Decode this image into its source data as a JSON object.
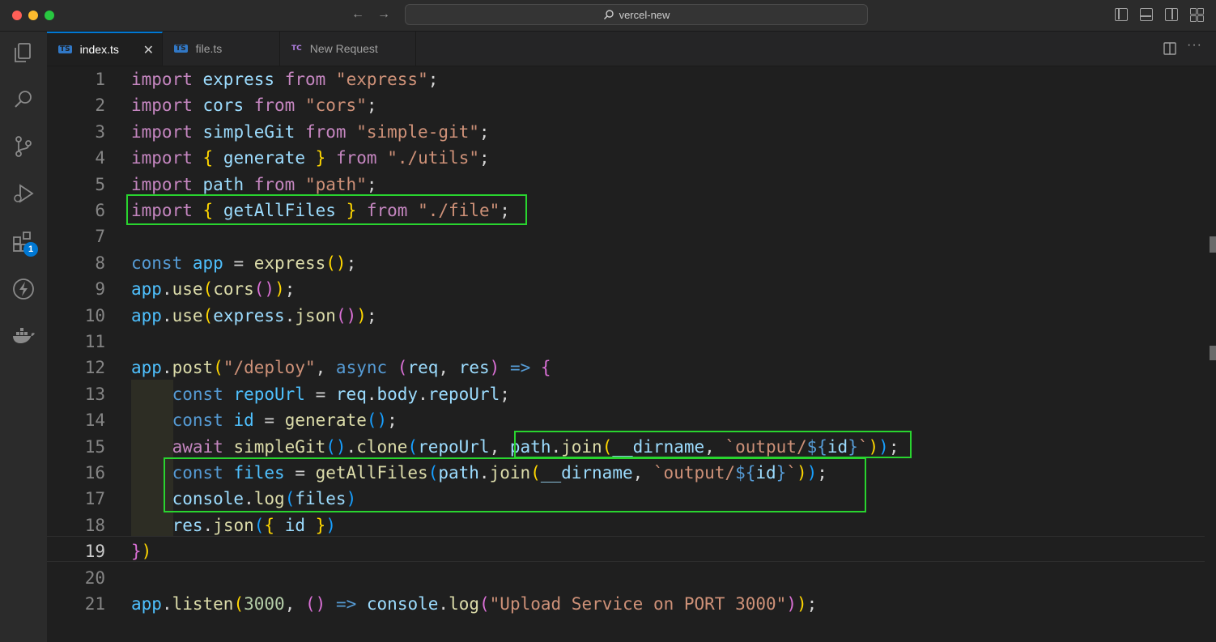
{
  "window": {
    "search_text": "vercel-new",
    "colors": {
      "close": "#ff5f57",
      "minimize": "#febc2e",
      "zoom": "#28c840",
      "accent": "#0078d4",
      "highlight": "#29d42f"
    }
  },
  "activity": {
    "extensions_badge": "1"
  },
  "tabs": [
    {
      "label": "index.ts",
      "icon": "TS",
      "active": true
    },
    {
      "label": "file.ts",
      "icon": "TS",
      "active": false
    },
    {
      "label": "New Request",
      "icon": "TC",
      "active": false
    }
  ],
  "editor": {
    "current_line": 19,
    "lines": [
      {
        "n": "1",
        "tokens": [
          [
            "kw",
            "import"
          ],
          [
            "pn",
            " "
          ],
          [
            "vr",
            "express"
          ],
          [
            "pn",
            " "
          ],
          [
            "kw",
            "from"
          ],
          [
            "pn",
            " "
          ],
          [
            "st",
            "\"express\""
          ],
          [
            "pn",
            ";"
          ]
        ]
      },
      {
        "n": "2",
        "tokens": [
          [
            "kw",
            "import"
          ],
          [
            "pn",
            " "
          ],
          [
            "vr",
            "cors"
          ],
          [
            "pn",
            " "
          ],
          [
            "kw",
            "from"
          ],
          [
            "pn",
            " "
          ],
          [
            "st",
            "\"cors\""
          ],
          [
            "pn",
            ";"
          ]
        ]
      },
      {
        "n": "3",
        "tokens": [
          [
            "kw",
            "import"
          ],
          [
            "pn",
            " "
          ],
          [
            "vr",
            "simpleGit"
          ],
          [
            "pn",
            " "
          ],
          [
            "kw",
            "from"
          ],
          [
            "pn",
            " "
          ],
          [
            "st",
            "\"simple-git\""
          ],
          [
            "pn",
            ";"
          ]
        ]
      },
      {
        "n": "4",
        "tokens": [
          [
            "kw",
            "import"
          ],
          [
            "pn",
            " "
          ],
          [
            "b1",
            "{"
          ],
          [
            "pn",
            " "
          ],
          [
            "vr",
            "generate"
          ],
          [
            "pn",
            " "
          ],
          [
            "b1",
            "}"
          ],
          [
            "pn",
            " "
          ],
          [
            "kw",
            "from"
          ],
          [
            "pn",
            " "
          ],
          [
            "st",
            "\"./utils\""
          ],
          [
            "pn",
            ";"
          ]
        ]
      },
      {
        "n": "5",
        "tokens": [
          [
            "kw",
            "import"
          ],
          [
            "pn",
            " "
          ],
          [
            "vr",
            "path"
          ],
          [
            "pn",
            " "
          ],
          [
            "kw",
            "from"
          ],
          [
            "pn",
            " "
          ],
          [
            "st",
            "\"path\""
          ],
          [
            "pn",
            ";"
          ]
        ]
      },
      {
        "n": "6",
        "tokens": [
          [
            "kw",
            "import"
          ],
          [
            "pn",
            " "
          ],
          [
            "b1",
            "{"
          ],
          [
            "pn",
            " "
          ],
          [
            "vr",
            "getAllFiles"
          ],
          [
            "pn",
            " "
          ],
          [
            "b1",
            "}"
          ],
          [
            "pn",
            " "
          ],
          [
            "kw",
            "from"
          ],
          [
            "pn",
            " "
          ],
          [
            "st",
            "\"./file\""
          ],
          [
            "pn",
            ";"
          ]
        ]
      },
      {
        "n": "7",
        "tokens": []
      },
      {
        "n": "8",
        "tokens": [
          [
            "dc",
            "const"
          ],
          [
            "pn",
            " "
          ],
          [
            "cn",
            "app"
          ],
          [
            "pn",
            " = "
          ],
          [
            "fn",
            "express"
          ],
          [
            "b1",
            "()"
          ],
          [
            "pn",
            ";"
          ]
        ]
      },
      {
        "n": "9",
        "tokens": [
          [
            "cn",
            "app"
          ],
          [
            "pn",
            "."
          ],
          [
            "fn",
            "use"
          ],
          [
            "b1",
            "("
          ],
          [
            "fn",
            "cors"
          ],
          [
            "b2",
            "()"
          ],
          [
            "b1",
            ")"
          ],
          [
            "pn",
            ";"
          ]
        ]
      },
      {
        "n": "10",
        "tokens": [
          [
            "cn",
            "app"
          ],
          [
            "pn",
            "."
          ],
          [
            "fn",
            "use"
          ],
          [
            "b1",
            "("
          ],
          [
            "vr",
            "express"
          ],
          [
            "pn",
            "."
          ],
          [
            "fn",
            "json"
          ],
          [
            "b2",
            "()"
          ],
          [
            "b1",
            ")"
          ],
          [
            "pn",
            ";"
          ]
        ]
      },
      {
        "n": "11",
        "tokens": []
      },
      {
        "n": "12",
        "tokens": [
          [
            "cn",
            "app"
          ],
          [
            "pn",
            "."
          ],
          [
            "fn",
            "post"
          ],
          [
            "b1",
            "("
          ],
          [
            "st",
            "\"/deploy\""
          ],
          [
            "pn",
            ", "
          ],
          [
            "dc",
            "async"
          ],
          [
            "pn",
            " "
          ],
          [
            "b2",
            "("
          ],
          [
            "vr",
            "req"
          ],
          [
            "pn",
            ", "
          ],
          [
            "vr",
            "res"
          ],
          [
            "b2",
            ")"
          ],
          [
            "pn",
            " "
          ],
          [
            "dc",
            "=>"
          ],
          [
            "pn",
            " "
          ],
          [
            "b2",
            "{"
          ]
        ]
      },
      {
        "n": "13",
        "tokens": [
          [
            "pn",
            "    "
          ],
          [
            "dc",
            "const"
          ],
          [
            "pn",
            " "
          ],
          [
            "cn",
            "repoUrl"
          ],
          [
            "pn",
            " = "
          ],
          [
            "vr",
            "req"
          ],
          [
            "pn",
            "."
          ],
          [
            "vr",
            "body"
          ],
          [
            "pn",
            "."
          ],
          [
            "vr",
            "repoUrl"
          ],
          [
            "pn",
            ";"
          ]
        ]
      },
      {
        "n": "14",
        "tokens": [
          [
            "pn",
            "    "
          ],
          [
            "dc",
            "const"
          ],
          [
            "pn",
            " "
          ],
          [
            "cn",
            "id"
          ],
          [
            "pn",
            " = "
          ],
          [
            "fn",
            "generate"
          ],
          [
            "b3",
            "()"
          ],
          [
            "pn",
            ";"
          ]
        ]
      },
      {
        "n": "15",
        "tokens": [
          [
            "pn",
            "    "
          ],
          [
            "kw",
            "await"
          ],
          [
            "pn",
            " "
          ],
          [
            "fn",
            "simpleGit"
          ],
          [
            "b3",
            "()"
          ],
          [
            "pn",
            "."
          ],
          [
            "fn",
            "clone"
          ],
          [
            "b3",
            "("
          ],
          [
            "vr",
            "repoUrl"
          ],
          [
            "pn",
            ", "
          ],
          [
            "vr",
            "path"
          ],
          [
            "pn",
            "."
          ],
          [
            "fn",
            "join"
          ],
          [
            "b1",
            "("
          ],
          [
            "vr",
            "__dirname"
          ],
          [
            "pn",
            ", "
          ],
          [
            "st",
            "`output/"
          ],
          [
            "dc",
            "${"
          ],
          [
            "vr",
            "id"
          ],
          [
            "dc",
            "}"
          ],
          [
            "st",
            "`"
          ],
          [
            "b1",
            ")"
          ],
          [
            "b3",
            ")"
          ],
          [
            "pn",
            ";"
          ]
        ]
      },
      {
        "n": "16",
        "tokens": [
          [
            "pn",
            "    "
          ],
          [
            "dc",
            "const"
          ],
          [
            "pn",
            " "
          ],
          [
            "cn",
            "files"
          ],
          [
            "pn",
            " = "
          ],
          [
            "fn",
            "getAllFiles"
          ],
          [
            "b3",
            "("
          ],
          [
            "vr",
            "path"
          ],
          [
            "pn",
            "."
          ],
          [
            "fn",
            "join"
          ],
          [
            "b1",
            "("
          ],
          [
            "vr",
            "__dirname"
          ],
          [
            "pn",
            ", "
          ],
          [
            "st",
            "`output/"
          ],
          [
            "dc",
            "${"
          ],
          [
            "vr",
            "id"
          ],
          [
            "dc",
            "}"
          ],
          [
            "st",
            "`"
          ],
          [
            "b1",
            ")"
          ],
          [
            "b3",
            ")"
          ],
          [
            "pn",
            ";"
          ]
        ]
      },
      {
        "n": "17",
        "tokens": [
          [
            "pn",
            "    "
          ],
          [
            "vr",
            "console"
          ],
          [
            "pn",
            "."
          ],
          [
            "fn",
            "log"
          ],
          [
            "b3",
            "("
          ],
          [
            "vr",
            "files"
          ],
          [
            "b3",
            ")"
          ]
        ]
      },
      {
        "n": "18",
        "tokens": [
          [
            "pn",
            "    "
          ],
          [
            "vr",
            "res"
          ],
          [
            "pn",
            "."
          ],
          [
            "fn",
            "json"
          ],
          [
            "b3",
            "("
          ],
          [
            "b1",
            "{"
          ],
          [
            "pn",
            " "
          ],
          [
            "vr",
            "id"
          ],
          [
            "pn",
            " "
          ],
          [
            "b1",
            "}"
          ],
          [
            "b3",
            ")"
          ]
        ]
      },
      {
        "n": "19",
        "tokens": [
          [
            "b2",
            "}"
          ],
          [
            "b1",
            ")"
          ]
        ]
      },
      {
        "n": "20",
        "tokens": []
      },
      {
        "n": "21",
        "tokens": [
          [
            "cn",
            "app"
          ],
          [
            "pn",
            "."
          ],
          [
            "fn",
            "listen"
          ],
          [
            "b1",
            "("
          ],
          [
            "nm",
            "3000"
          ],
          [
            "pn",
            ", "
          ],
          [
            "b2",
            "()"
          ],
          [
            "pn",
            " "
          ],
          [
            "dc",
            "=>"
          ],
          [
            "pn",
            " "
          ],
          [
            "vr",
            "console"
          ],
          [
            "pn",
            "."
          ],
          [
            "fn",
            "log"
          ],
          [
            "b2",
            "("
          ],
          [
            "st",
            "\"Upload Service on PORT 3000\""
          ],
          [
            "b2",
            ")"
          ],
          [
            "b1",
            ")"
          ],
          [
            "pn",
            ";"
          ]
        ]
      }
    ]
  }
}
